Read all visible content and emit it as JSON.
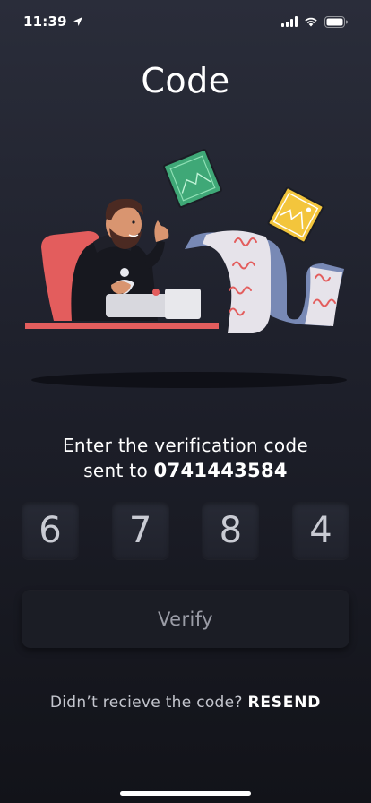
{
  "status_bar": {
    "time": "11:39",
    "icons": [
      "location-arrow-icon",
      "cellular-signal-icon",
      "wifi-icon",
      "battery-icon"
    ]
  },
  "screen": {
    "title": "Code"
  },
  "verification": {
    "message_line1": "Enter the verification code",
    "message_prefix": "sent to",
    "phone_number": "0741443584",
    "digits": [
      "6",
      "7",
      "8",
      "4"
    ]
  },
  "actions": {
    "verify_label": "Verify",
    "resend_prompt": "Didn’t recieve the code?",
    "resend_label": "RESEND"
  },
  "colors": {
    "background_top": "#2a2d3a",
    "background_bottom": "#121319",
    "accent_red": "#e85a5a",
    "paper_blue": "#7889b5",
    "card_green": "#3fa877",
    "card_yellow": "#f3c53c"
  }
}
